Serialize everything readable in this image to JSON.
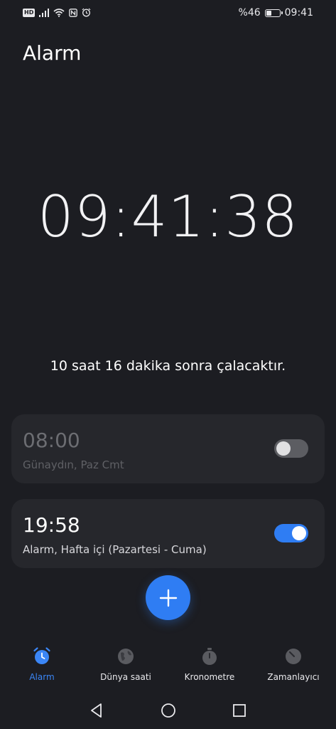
{
  "status_bar": {
    "network_badge": "HD",
    "battery_percent": "%46",
    "battery_level": 0.46,
    "time": "09:41"
  },
  "header": {
    "title": "Alarm"
  },
  "clock": {
    "time": "09:41:38"
  },
  "next_alarm": {
    "text": "10 saat 16 dakika sonra çalacaktır."
  },
  "alarms": [
    {
      "time": "08:00",
      "label": "Günaydın, Paz Cmt",
      "enabled": false
    },
    {
      "time": "19:58",
      "label": "Alarm, Hafta içi (Pazartesi - Cuma)",
      "enabled": true
    }
  ],
  "fab": {
    "icon": "plus-icon"
  },
  "bottom_nav": {
    "items": [
      {
        "label": "Alarm",
        "icon": "alarm-clock-icon",
        "active": true
      },
      {
        "label": "Dünya saati",
        "icon": "globe-icon",
        "active": false
      },
      {
        "label": "Kronometre",
        "icon": "stopwatch-icon",
        "active": false
      },
      {
        "label": "Zamanlayıcı",
        "icon": "timer-icon",
        "active": false
      }
    ]
  },
  "system_nav": {
    "icons": [
      "back-icon",
      "home-icon",
      "recents-icon"
    ]
  },
  "colors": {
    "background": "#1c1d22",
    "card": "#26272c",
    "accent": "#2f7df3",
    "active_nav": "#3b86f6"
  }
}
